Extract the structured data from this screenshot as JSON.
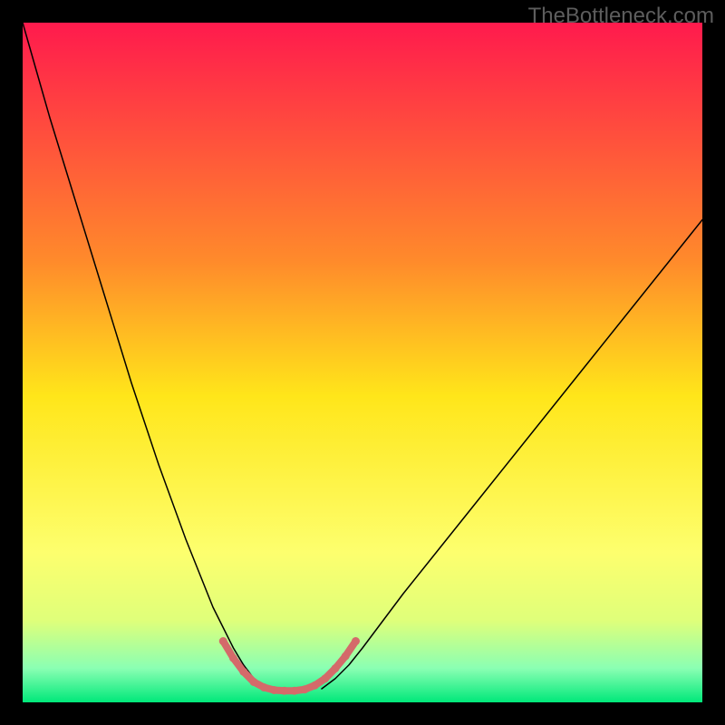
{
  "watermark": "TheBottleneck.com",
  "chart_data": {
    "type": "line",
    "title": "",
    "xlabel": "",
    "ylabel": "",
    "xlim": [
      0,
      100
    ],
    "ylim": [
      0,
      100
    ],
    "background_gradient": {
      "stops": [
        {
          "offset": 0.0,
          "color": "#ff1a4d"
        },
        {
          "offset": 0.35,
          "color": "#ff8a2b"
        },
        {
          "offset": 0.55,
          "color": "#ffe61a"
        },
        {
          "offset": 0.78,
          "color": "#fdff6e"
        },
        {
          "offset": 0.88,
          "color": "#dfff7a"
        },
        {
          "offset": 0.95,
          "color": "#8affb3"
        },
        {
          "offset": 1.0,
          "color": "#00e87a"
        }
      ]
    },
    "series": [
      {
        "name": "left-curve",
        "color": "#000000",
        "width": 1.5,
        "x": [
          0,
          2,
          4,
          6,
          8,
          10,
          12,
          14,
          16,
          18,
          20,
          22,
          24,
          26,
          28,
          29.5,
          31,
          32.5,
          34,
          36
        ],
        "y": [
          100,
          93,
          86,
          79.5,
          73,
          66.5,
          60,
          53.5,
          47,
          41,
          35,
          29.5,
          24,
          19,
          14,
          11,
          8,
          5.5,
          3.5,
          2
        ]
      },
      {
        "name": "right-curve",
        "color": "#000000",
        "width": 1.5,
        "x": [
          44,
          46,
          48,
          50,
          53,
          56,
          60,
          64,
          68,
          72,
          76,
          80,
          84,
          88,
          92,
          96,
          100
        ],
        "y": [
          2,
          3.5,
          5.5,
          8,
          12,
          16,
          21,
          26,
          31,
          36,
          41,
          46,
          51,
          56,
          61,
          66,
          71
        ]
      },
      {
        "name": "optimal-band",
        "color": "#d46a6a",
        "width": 8,
        "x": [
          29.5,
          31,
          32.5,
          34,
          35.5,
          37,
          38.5,
          40,
          41.5,
          43,
          44.5,
          46,
          47.5,
          49
        ],
        "y": [
          9,
          6.5,
          4.5,
          3,
          2.2,
          1.8,
          1.7,
          1.7,
          1.9,
          2.5,
          3.5,
          5,
          6.8,
          9
        ]
      }
    ],
    "markers": {
      "name": "optimal-band-dots",
      "color": "#d46a6a",
      "radius": 4.5,
      "x": [
        29.5,
        31,
        32.5,
        34,
        35.5,
        37,
        38.5,
        40,
        41.5,
        43,
        44.5,
        46,
        47.5,
        49
      ],
      "y": [
        9,
        6.5,
        4.5,
        3,
        2.2,
        1.8,
        1.7,
        1.7,
        1.9,
        2.5,
        3.5,
        5,
        6.8,
        9
      ]
    }
  }
}
